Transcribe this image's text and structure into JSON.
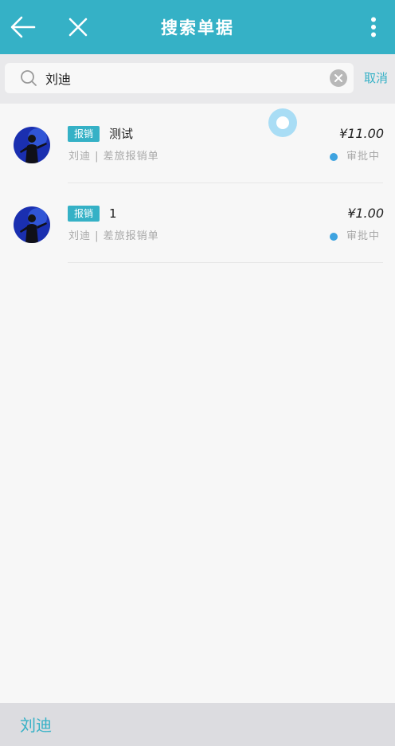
{
  "header": {
    "title": "搜索单据",
    "back_icon": "arrow-left-icon",
    "close_icon": "close-icon",
    "more_icon": "more-vertical-icon",
    "background_color": "#35b1c6"
  },
  "search": {
    "value": "刘迪",
    "icon": "search-icon",
    "clear_icon": "clear-icon",
    "cancel_label": "取消"
  },
  "results": [
    {
      "type_badge": "报销",
      "title": "测试",
      "amount": "¥11.00",
      "subtitle": "刘迪 | 差旅报销单",
      "status": "审批中",
      "status_color": "#3ea3e0"
    },
    {
      "type_badge": "报销",
      "title": "1",
      "amount": "¥1.00",
      "subtitle": "刘迪 | 差旅报销单",
      "status": "审批中",
      "status_color": "#3ea3e0"
    }
  ],
  "suggestion": {
    "text": "刘迪"
  },
  "colors": {
    "accent": "#35b1c6",
    "status_dot": "#3ea3e0",
    "muted_text": "#a8a8a8"
  }
}
